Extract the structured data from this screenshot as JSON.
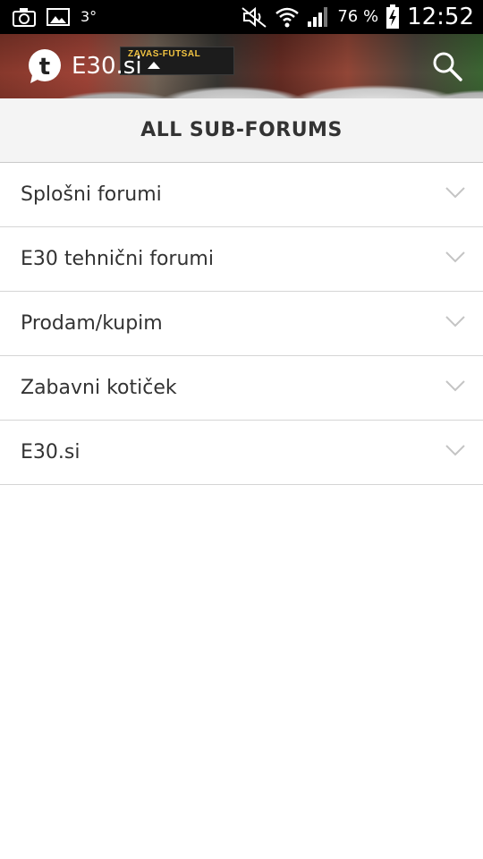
{
  "status_bar": {
    "temperature": "3°",
    "battery_percent": "76 %",
    "time": "12:52",
    "icons": [
      "camera-icon",
      "image-icon",
      "mute-icon",
      "wifi-icon",
      "signal-icon",
      "battery-charging-icon"
    ]
  },
  "header": {
    "brand_name": "E30.si",
    "banner_text": "ZAVAS-FUTSAL"
  },
  "title": "ALL SUB-FORUMS",
  "forums": [
    {
      "label": "Splošni forumi"
    },
    {
      "label": "E30 tehnični forumi"
    },
    {
      "label": "Prodam/kupim"
    },
    {
      "label": "Zabavni kotiček"
    },
    {
      "label": "E30.si"
    }
  ],
  "colors": {
    "status_bar_bg": "#000000",
    "title_bar_bg": "#f4f4f4",
    "text": "#333333",
    "divider": "#d5d5d5",
    "chevron": "#c4c4c4"
  }
}
